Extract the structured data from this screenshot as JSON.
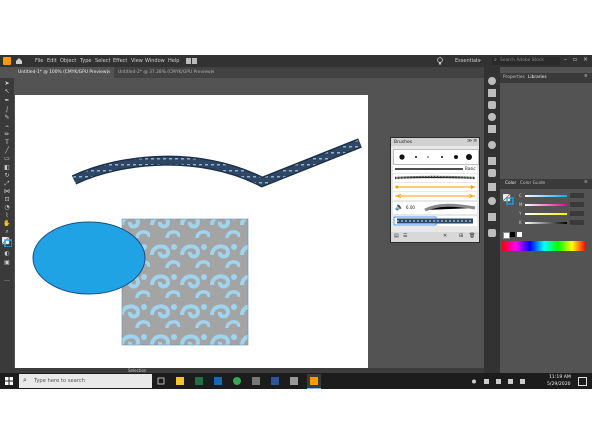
{
  "app": {
    "menu": [
      "File",
      "Edit",
      "Object",
      "Type",
      "Select",
      "Effect",
      "View",
      "Window",
      "Help"
    ],
    "workspace": "Essentials",
    "search_placeholder": "Search Adobe Stock"
  },
  "tabs": [
    {
      "label": "Untitled-1* @ 100% (CMYK/GPU Preview)"
    },
    {
      "label": "Untitled-2* @ 37.28% (CMYK/GPU Preview)"
    }
  ],
  "brushes_panel": {
    "title": "Brushes",
    "basic_label": "Basic",
    "size_value": "6.00"
  },
  "right_panel": {
    "tab_properties": "Properties",
    "tab_libraries": "Libraries",
    "tab_color": "Color",
    "tab_color_guide": "Color Guide",
    "channels": [
      "C",
      "M",
      "Y",
      "K"
    ]
  },
  "status": {
    "tool": "Selection"
  },
  "taskbar": {
    "search_placeholder": "Type here to search",
    "time": "11:19 AM",
    "date": "5/29/2020"
  },
  "colors": {
    "shape_fill": "#1fa3e4",
    "pattern_light": "#9fd4ef",
    "pattern_gray": "#9e9e9e",
    "accent_orange": "#ff9a00",
    "ui_dark": "#323232",
    "ui_mid": "#535353"
  },
  "icons": [
    "home-icon",
    "lightbulb-icon",
    "search-icon",
    "arrange-icon",
    "windows-logo-icon"
  ]
}
